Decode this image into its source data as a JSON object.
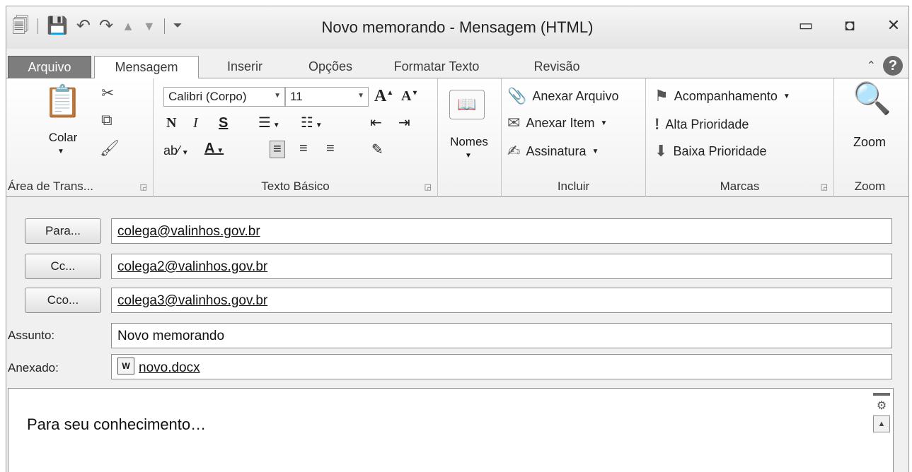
{
  "window": {
    "title": "Novo memorando - Mensagem (HTML)",
    "quick_access": [
      "app-icon",
      "save-icon",
      "undo-icon",
      "redo-icon",
      "up-arrow-icon",
      "down-arrow-icon",
      "customize-icon"
    ]
  },
  "tabs": [
    "Arquivo",
    "Mensagem",
    "Inserir",
    "Opções",
    "Formatar Texto",
    "Revisão"
  ],
  "ribbon": {
    "clipboard": {
      "paste_label": "Colar",
      "group_label": "Área de Trans..."
    },
    "basic_text": {
      "font_name": "Calibri (Corpo)",
      "font_size": "11",
      "bold": "N",
      "italic": "I",
      "underline": "S",
      "group_label": "Texto Básico"
    },
    "names": {
      "label": "Nomes"
    },
    "include": {
      "attach_file": "Anexar Arquivo",
      "attach_item": "Anexar Item",
      "signature": "Assinatura",
      "group_label": "Incluir"
    },
    "tags": {
      "follow_up": "Acompanhamento",
      "high_priority": "Alta Prioridade",
      "low_priority": "Baixa Prioridade",
      "group_label": "Marcas"
    },
    "zoom": {
      "label": "Zoom",
      "group_label": "Zoom"
    }
  },
  "compose": {
    "to_button": "Para...",
    "to_value": "colega@valinhos.gov.br",
    "cc_button": "Cc...",
    "cc_value": "colega2@valinhos.gov.br",
    "bcc_button": "Cco...",
    "bcc_value": "colega3@valinhos.gov.br",
    "subject_label": "Assunto:",
    "subject_value": "Novo memorando",
    "attached_label": "Anexado:",
    "attached_file": "novo.docx",
    "body_text": "Para seu conhecimento…"
  }
}
